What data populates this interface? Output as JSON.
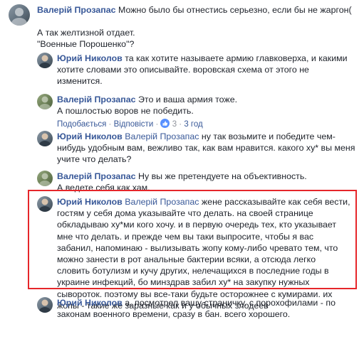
{
  "comments": [
    {
      "id": "c1",
      "author": "Валерій Прозапас",
      "lines": [
        "Можно было бы отнестись серьезно, если бы не жаргон(",
        "",
        "А так желтизной отдает.",
        "\"Военные Порошенко\"?"
      ]
    },
    {
      "id": "c2",
      "author": "Юрий Николов",
      "text": "та как хотите называете армию главковерха, и какими хотите словами это описывайте. воровская схема от этого не изменится."
    },
    {
      "id": "c3",
      "author": "Валерій Прозапас",
      "line1": "Это и ваша армия тоже.",
      "line2": "А пошлостью воров не победить.",
      "actions": {
        "like": "Подобається",
        "reply": "Відповісти",
        "reactions": "3",
        "time": "3 год"
      }
    },
    {
      "id": "c4",
      "author": "Юрий Николов",
      "mention": "Валерій Прозапас",
      "text": "ну так возьмите и победите чем-нибудь удобным вам, вежливо так, как вам нравится. какого ху* вы меня учите что делать?"
    },
    {
      "id": "c5",
      "author": "Валерій Прозапас",
      "line1": "Ну вы же претендуете на объективность.",
      "line2": "А ведете себя как хам."
    },
    {
      "id": "c6",
      "author": "Юрий Николов",
      "mention": "Валерій Прозапас",
      "text": "жене рассказывайте как себя вести, гостям у себя дома указывайте что делать. на своей странице обкладываю ху*ми кого хочу. и в первую очередь тех, кто указывает мне что делать. и прежде чем вы таки выпросите, чтобы я вас забанил, напоминаю - вылизывать жопу кому-либо чревато тем, что можно занести в рот анальные бактерии всяки, а отсюда легко словить ботулизм и кучу других, нелечащихся в последние годы в украине инфекций, бо минздрав забил ху* на закупку нужных сывороток. поэтому вы все-таки будьте осторожнее с кумирами. их жопы - такие же заразные как и у обычных злодеев"
    },
    {
      "id": "c7",
      "author": "Юрий Николов",
      "text": "а, посмотрел вашу страничку. с порохофилами - по законам военного времени, сразу в бан. всего хорошего."
    }
  ],
  "icons": {
    "reply": "reply-arrow-icon",
    "reactions": "like-reaction-icon"
  },
  "colors": {
    "link": "#385898",
    "text": "#1d2129",
    "meta": "#90949c",
    "highlight": "#e6262a",
    "reaction_blue": "#5890ff"
  }
}
